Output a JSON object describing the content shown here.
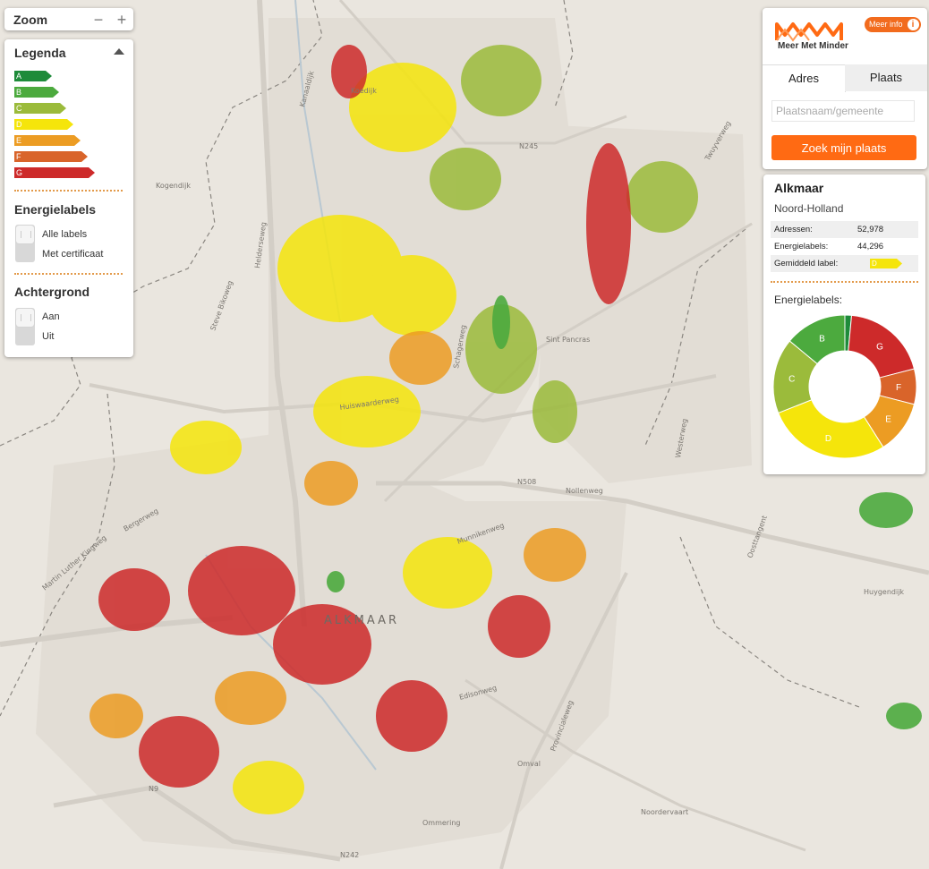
{
  "zoom": {
    "title": "Zoom",
    "minus": "−",
    "plus": "+"
  },
  "legend": {
    "title": "Legenda",
    "labels": [
      {
        "letter": "A",
        "color": "#1e8b3a"
      },
      {
        "letter": "B",
        "color": "#4caa3e"
      },
      {
        "letter": "C",
        "color": "#9bbb3b"
      },
      {
        "letter": "D",
        "color": "#f5e50b"
      },
      {
        "letter": "E",
        "color": "#ec9c23"
      },
      {
        "letter": "F",
        "color": "#d9642a"
      },
      {
        "letter": "G",
        "color": "#cd2a2a"
      }
    ],
    "energielabels_title": "Energielabels",
    "energielabels_options": [
      "Alle labels",
      "Met certificaat"
    ],
    "achtergrond_title": "Achtergrond",
    "achtergrond_options": [
      "Aan",
      "Uit"
    ]
  },
  "brand": {
    "name": "Meer Met Minder",
    "meer_info": "Meer info",
    "info_glyph": "i",
    "accent": "#ff6a13"
  },
  "search": {
    "tabs": [
      "Adres",
      "Plaats"
    ],
    "placeholder": "Plaatsnaam/gemeente",
    "button": "Zoek mijn plaats"
  },
  "info": {
    "city": "Alkmaar",
    "province": "Noord-Holland",
    "stats": [
      {
        "label": "Adressen:",
        "value": "52,978"
      },
      {
        "label": "Energielabels:",
        "value": "44,296"
      }
    ],
    "avg_label_key": "Gemiddeld label:",
    "avg_label": "D",
    "chart_title": "Energielabels:"
  },
  "chart_data": {
    "type": "pie",
    "title": "Energielabels:",
    "hole": true,
    "slices": [
      {
        "label": "A",
        "value": 1.5,
        "color": "#1e8b3a"
      },
      {
        "label": "G",
        "value": 19.5,
        "color": "#cd2a2a"
      },
      {
        "label": "F",
        "value": 8,
        "color": "#d9642a"
      },
      {
        "label": "E",
        "value": 12,
        "color": "#ec9c23"
      },
      {
        "label": "D",
        "value": 28,
        "color": "#f5e50b"
      },
      {
        "label": "C",
        "value": 17,
        "color": "#9bbb3b"
      },
      {
        "label": "B",
        "value": 14,
        "color": "#4caa3e"
      }
    ]
  },
  "map": {
    "place_labels": [
      "ALKMAAR",
      "Koedijk",
      "Sint Pancras",
      "Omval",
      "Ommering",
      "Huygendijk"
    ],
    "road_labels": [
      "Huiswaarderweg",
      "Nollenweg",
      "N508",
      "N245",
      "N242",
      "N9",
      "Helderseweg",
      "Kanaaldijk",
      "Munnikenweg",
      "Edisonweg",
      "Provincialeweg",
      "Noordervaart",
      "Oosttangent",
      "Bergerweg",
      "Martin Luther Kingweg",
      "Steve Bikoweg",
      "Kogendijk",
      "Schagerweg",
      "Westerweg",
      "Twuyverweg"
    ]
  }
}
